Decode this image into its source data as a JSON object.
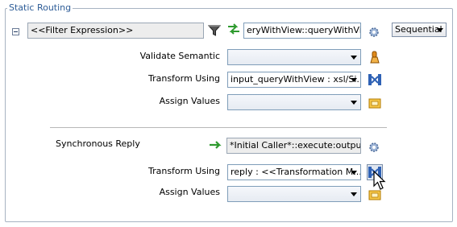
{
  "panel": {
    "title": "Static Routing"
  },
  "filter": {
    "expression": "<<Filter Expression>>"
  },
  "service": {
    "value": "eryWithView::queryWithView"
  },
  "execution_mode": {
    "value": "Sequential"
  },
  "request": {
    "validate_semantic_label": "Validate Semantic",
    "validate_semantic_value": "",
    "transform_label": "Transform Using",
    "transform_value": "input_queryWithView : xsl/Si...",
    "assign_label": "Assign Values",
    "assign_value": ""
  },
  "reply": {
    "section_label": "Synchronous Reply",
    "target_value": "*Initial Caller*::execute:output",
    "transform_label": "Transform Using",
    "transform_value": "reply : <<Transformation M...",
    "assign_label": "Assign Values",
    "assign_value": ""
  },
  "colors": {
    "title_text": "#2d5c97",
    "field_border": "#7f9db9",
    "arrow_green": "#2e9a2e"
  },
  "icons": {
    "filter": "funnel-icon",
    "routing": "double-arrow-icon",
    "settings": "gear-icon",
    "validate": "schematron-icon",
    "transform": "transformation-map-icon",
    "assign": "assign-values-icon",
    "reply_arrow": "green-arrow-icon",
    "cursor": "mouse-pointer-icon"
  }
}
